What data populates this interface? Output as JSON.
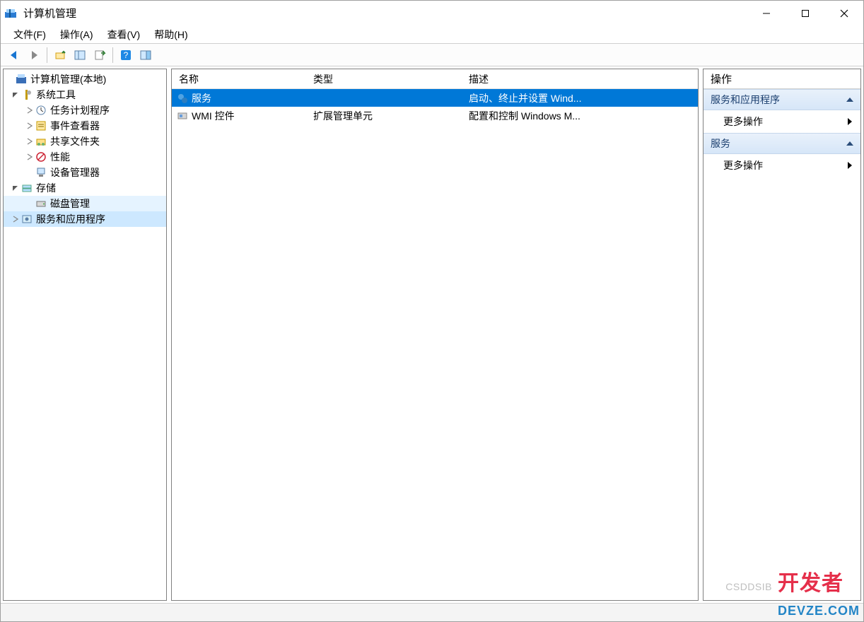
{
  "window": {
    "title": "计算机管理"
  },
  "menubar": [
    "文件(F)",
    "操作(A)",
    "查看(V)",
    "帮助(H)"
  ],
  "tree": {
    "root": "计算机管理(本地)",
    "system_tools": "系统工具",
    "task_scheduler": "任务计划程序",
    "event_viewer": "事件查看器",
    "shared_folders": "共享文件夹",
    "performance": "性能",
    "device_manager": "设备管理器",
    "storage": "存储",
    "disk_management": "磁盘管理",
    "services_apps": "服务和应用程序"
  },
  "list": {
    "headers": {
      "name": "名称",
      "type": "类型",
      "desc": "描述"
    },
    "rows": [
      {
        "name": "服务",
        "type": "",
        "desc": "启动、终止并设置 Wind...",
        "selected": true
      },
      {
        "name": "WMI 控件",
        "type": "扩展管理单元",
        "desc": "配置和控制 Windows M...",
        "selected": false
      }
    ]
  },
  "actions": {
    "title": "操作",
    "groups": [
      {
        "header": "服务和应用程序",
        "items": [
          "更多操作"
        ]
      },
      {
        "header": "服务",
        "items": [
          "更多操作"
        ]
      }
    ]
  },
  "watermark": {
    "left": "CSDDSIB",
    "right_a": "开发者",
    "right_b": "DEVZE.COM"
  }
}
